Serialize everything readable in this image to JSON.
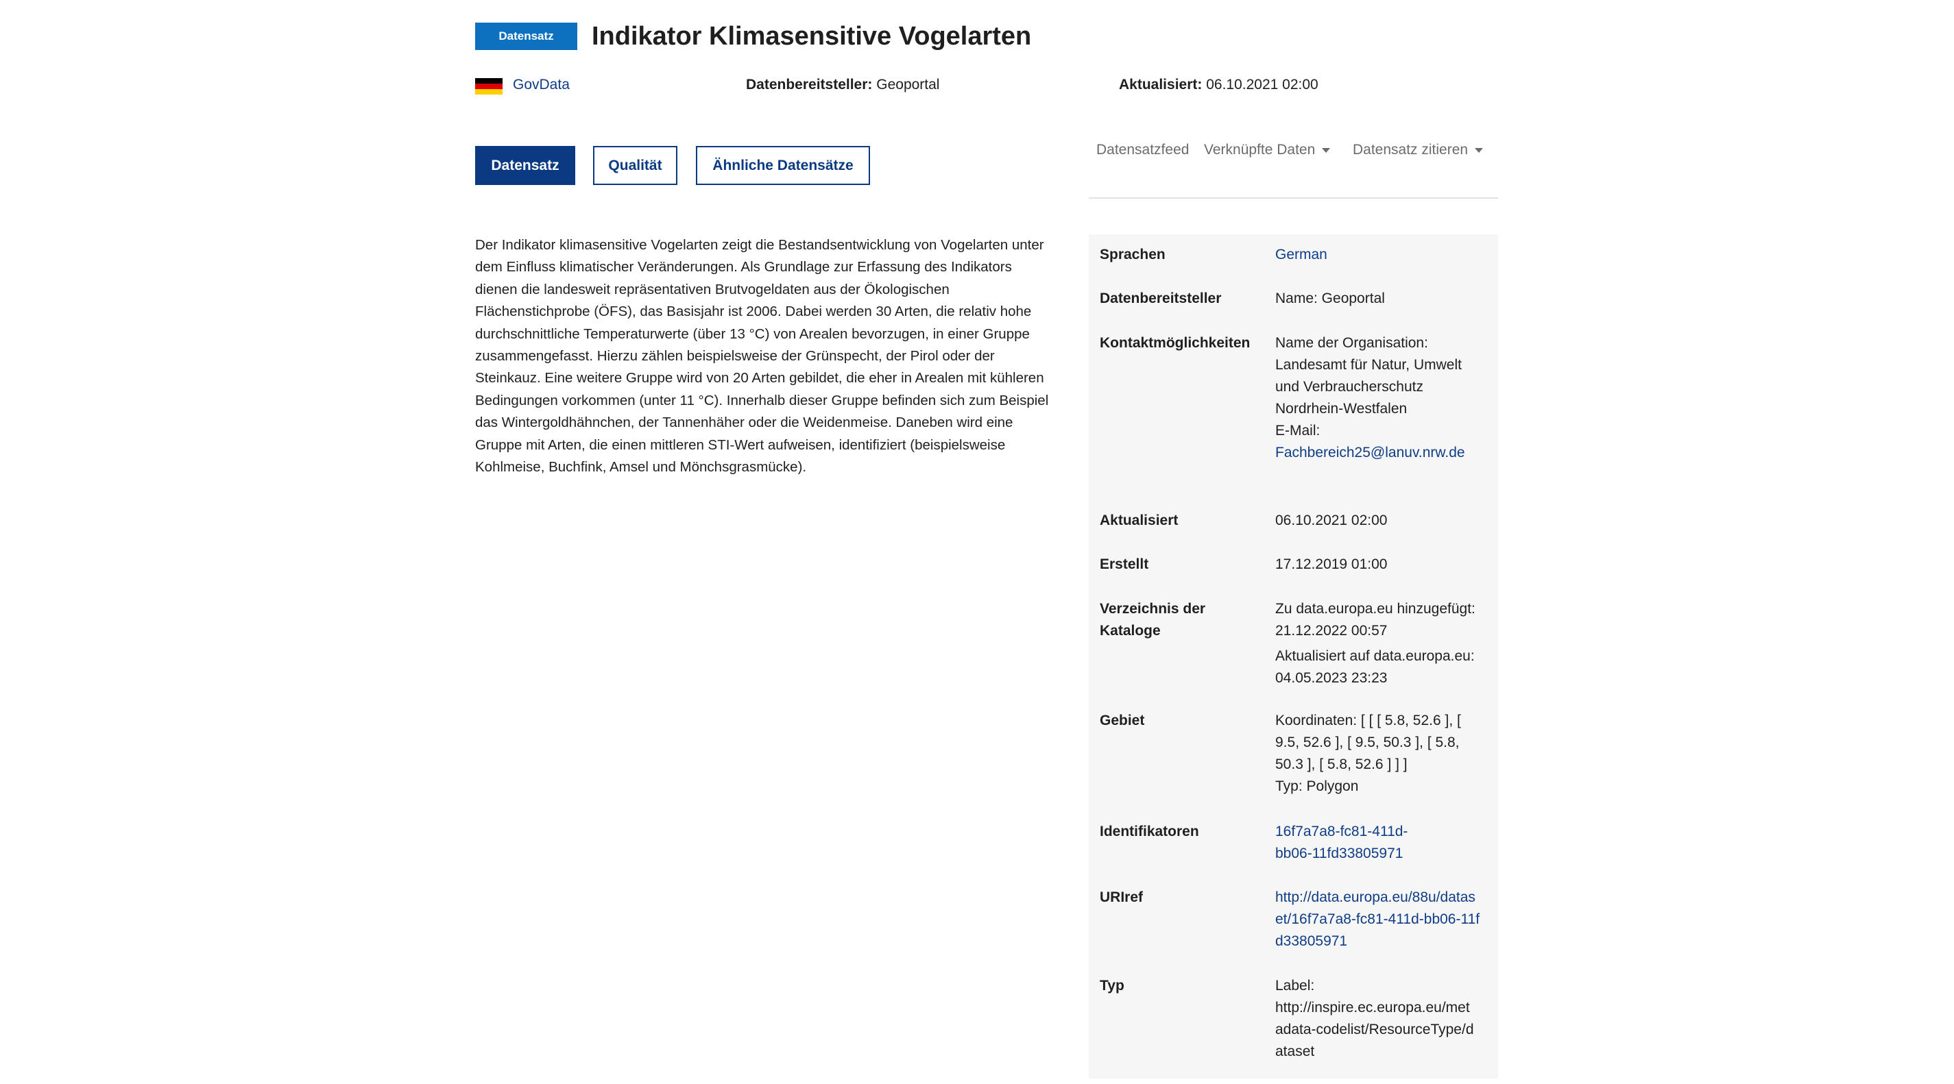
{
  "header": {
    "badge": "Datensatz",
    "title": "Indikator Klimasensitive Vogelarten",
    "catalog_link": "GovData",
    "provider_label": "Datenbereitsteller:",
    "provider_value": "Geoportal",
    "updated_label": "Aktualisiert:",
    "updated_value": "06.10.2021 02:00"
  },
  "tabs": [
    {
      "label": "Datensatz",
      "active": true
    },
    {
      "label": "Qualität",
      "active": false
    },
    {
      "label": "Ähnliche Datensätze",
      "active": false
    }
  ],
  "toolbar": {
    "feed": "Datensatzfeed",
    "linked": "Verknüpfte Daten",
    "cite": "Datensatz zitieren"
  },
  "description": "Der Indikator klimasensitive Vogelarten zeigt die Bestandsentwicklung von Vogelarten unter dem Einfluss klimatischer Veränderungen. Als Grundlage zur Erfassung des Indikators dienen die landesweit repräsentativen Brutvogeldaten aus der Ökologischen Flächenstichprobe (ÖFS), das Basisjahr ist 2006. Dabei werden 30 Arten, die relativ hohe durchschnittliche Temperaturwerte (über 13 °C) von Arealen bevorzugen, in einer Gruppe zusammengefasst. Hierzu zählen beispielsweise der Grünspecht, der Pirol oder der Steinkauz. Eine weitere Gruppe wird von 20 Arten gebildet, die eher in Arealen mit kühleren Bedingungen vorkommen (unter 11 °C). Innerhalb dieser Gruppe befinden sich zum Beispiel das Wintergoldhähnchen, der Tannenhäher oder die Weidenmeise. Daneben wird eine Gruppe mit Arten, die einen mittleren STI-Wert aufweisen, identifiziert (beispielsweise Kohlmeise, Buchfink, Amsel und Mönchsgrasmücke).",
  "info": {
    "sprachen": {
      "label": "Sprachen",
      "value": "German"
    },
    "datenbereitsteller": {
      "label": "Datenbereitsteller",
      "value": "Name: Geoportal"
    },
    "kontakt": {
      "label": "Kontaktmöglichkeiten",
      "org_label": "Name der Organisation:",
      "org_value": "Landesamt für Natur, Umwelt und Verbraucherschutz Nordrhein-Westfalen",
      "email_label": "E-Mail:",
      "email_value": "Fachbereich25@lanuv.nrw.de"
    },
    "aktualisiert": {
      "label": "Aktualisiert",
      "value": "06.10.2021 02:00"
    },
    "erstellt": {
      "label": "Erstellt",
      "value": "17.12.2019 01:00"
    },
    "verzeichnis": {
      "label": "Verzeichnis der Kataloge",
      "added": "Zu data.europa.eu hinzugefügt: 21.12.2022 00:57",
      "updated": "Aktualisiert auf data.europa.eu: 04.05.2023 23:23"
    },
    "gebiet": {
      "label": "Gebiet",
      "coords": "Koordinaten: [ [ [ 5.8, 52.6 ], [ 9.5, 52.6 ], [ 9.5, 50.3 ], [ 5.8, 50.3 ], [ 5.8, 52.6 ] ] ]",
      "type": "Typ: Polygon"
    },
    "identifikatoren": {
      "label": "Identifikatoren",
      "value": "16f7a7a8-fc81-411d-bb06-11fd33805971"
    },
    "uriref": {
      "label": "URIref",
      "value": "http://data.europa.eu/88u/dataset/16f7a7a8-fc81-411d-bb06-11fd33805971"
    },
    "typ": {
      "label": "Typ",
      "value_label": "Label:",
      "value": "http://inspire.ec.europa.eu/metadata-codelist/ResourceType/dataset"
    }
  }
}
